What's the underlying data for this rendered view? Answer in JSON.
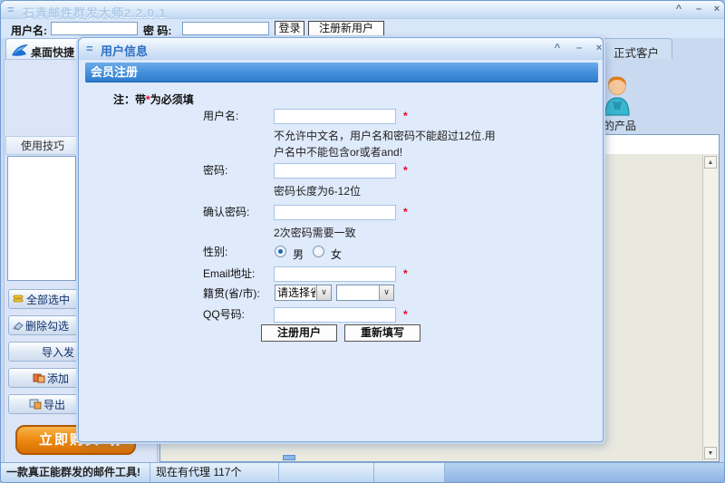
{
  "window": {
    "title": "石青邮件群发大师2.2.0.1"
  },
  "icons": {
    "menu": "=",
    "minimize": "–",
    "restore": "^",
    "close": "×",
    "dropdown": "∨",
    "scroll_up": "▲",
    "scroll_down": "▼"
  },
  "login_bar": {
    "username_label": "用户名:",
    "username_value": "",
    "password_label": "密 码:",
    "password_value": "",
    "login_button": "登录",
    "register_button": "注册新用户"
  },
  "tabs": {
    "desktop_tab": "桌面快捷",
    "client_tab": "正式客户"
  },
  "sidebar": {
    "tips_header": "使用技巧",
    "select_all_button": "全部选中",
    "delete_checked_button": "删除勾选",
    "import_button": "导入发",
    "add_button": "添加",
    "export_button": "导出",
    "buy_button": "立即购买"
  },
  "right_panel": {
    "product_caption": "的产品"
  },
  "dialog": {
    "title": "用户信息",
    "section_header": "会员注册",
    "note": {
      "prefix": "注：带",
      "star": "*",
      "suffix": "为必须填"
    },
    "required_mark": "*",
    "form": {
      "username": {
        "label": "用户名:",
        "value": "",
        "note_line1": "不允许中文名，用户名和密码不能超过12位.用",
        "note_line2": "户名中不能包含or或者and!"
      },
      "password": {
        "label": "密码:",
        "value": "",
        "note": "密码长度为6-12位"
      },
      "confirm_password": {
        "label": "确认密码:",
        "value": "",
        "note": "2次密码需要一致"
      },
      "gender": {
        "label": "性别:",
        "male": "男",
        "female": "女",
        "selected": "男"
      },
      "email": {
        "label": "Email地址:",
        "value": ""
      },
      "region": {
        "label": "籍贯(省/市):",
        "province_select": "请选择省",
        "city_select": ""
      },
      "qq": {
        "label": "QQ号码:",
        "value": ""
      }
    },
    "buttons": {
      "submit": "注册用户",
      "reset": "重新填写"
    }
  },
  "statusbar": {
    "slogan": "一款真正能群发的邮件工具!",
    "agents": "现在有代理 117个"
  }
}
